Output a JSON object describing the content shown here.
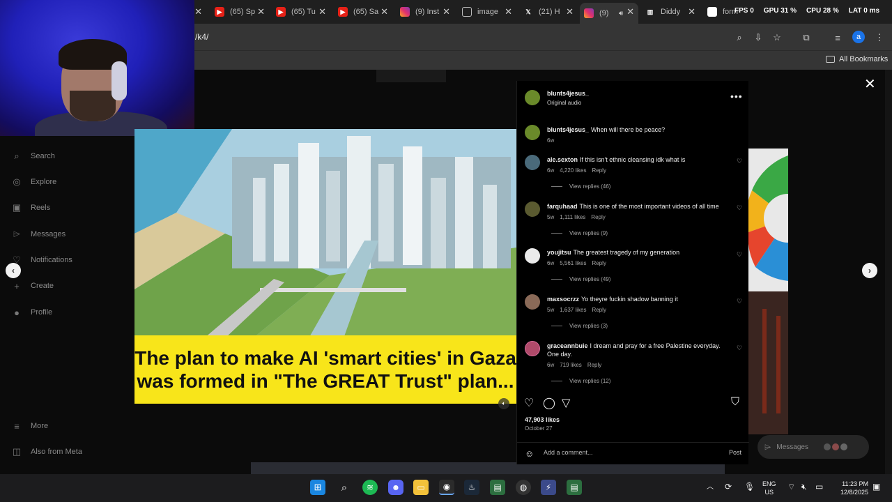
{
  "browser": {
    "tabs": [
      {
        "label": "(65) Sp",
        "icon": "youtube-icon"
      },
      {
        "label": "(65) Tu",
        "icon": "youtube-icon"
      },
      {
        "label": "(65) Sa",
        "icon": "youtube-icon"
      },
      {
        "label": "(9) Inst",
        "icon": "instagram-icon"
      },
      {
        "label": "image",
        "icon": "globe-icon"
      },
      {
        "label": "(21) H",
        "icon": "x-icon"
      },
      {
        "label": "(9)",
        "icon": "instagram-icon"
      },
      {
        "label": "Diddy",
        "icon": "app-icon"
      },
      {
        "label": "form",
        "icon": "google-icon"
      }
    ],
    "url": "/k4/",
    "all_bookmarks": "All Bookmarks",
    "profile_initial": "a"
  },
  "overlay_stats": {
    "fps_label": "FPS",
    "fps": "0",
    "gpu_label": "GPU",
    "gpu": "31 %",
    "cpu_label": "CPU",
    "cpu": "28 %",
    "lat_label": "LAT",
    "lat": "0 ms"
  },
  "sidebar": {
    "items": [
      {
        "label": "Search",
        "icon": "search-icon"
      },
      {
        "label": "Explore",
        "icon": "compass-icon"
      },
      {
        "label": "Reels",
        "icon": "reels-icon"
      },
      {
        "label": "Messages",
        "icon": "messenger-icon"
      },
      {
        "label": "Notifications",
        "icon": "heart-icon"
      },
      {
        "label": "Create",
        "icon": "plus-icon"
      },
      {
        "label": "Profile",
        "icon": "avatar-icon"
      },
      {
        "label": "More",
        "icon": "menu-icon"
      },
      {
        "label": "Also from Meta",
        "icon": "meta-icon"
      }
    ]
  },
  "media": {
    "caption_line1": "The plan to make AI 'smart cities' in Gaza",
    "caption_line2": "was formed in \"The GREAT Trust\" plan..."
  },
  "post": {
    "username": "blunts4jesus_",
    "audio": "Original audio",
    "caption_user": "blunts4jesus_",
    "caption_text": "When will there be peace?",
    "caption_age": "6w",
    "likes": "47,903 likes",
    "date": "October 27",
    "comment_placeholder": "Add a comment...",
    "post_label": "Post"
  },
  "comments": [
    {
      "user": "ale.sexton",
      "text": "If this isn't ethnic cleansing idk what is",
      "age": "6w",
      "likes": "4,220 likes",
      "reply": "Reply",
      "replies": "View replies (46)"
    },
    {
      "user": "farquhaad",
      "text": "This is one of the most important videos of all time",
      "age": "5w",
      "likes": "1,111 likes",
      "reply": "Reply",
      "replies": "View replies (9)"
    },
    {
      "user": "youjitsu",
      "text": "The greatest tragedy of my generation",
      "age": "6w",
      "likes": "5,561 likes",
      "reply": "Reply",
      "replies": "View replies (49)"
    },
    {
      "user": "maxsocrzz",
      "text": "Yo theyre fuckin shadow banning it",
      "age": "5w",
      "likes": "1,637 likes",
      "reply": "Reply",
      "replies": "View replies (3)"
    },
    {
      "user": "graceannbuie",
      "text": "I dream and pray for a free Palestine everyday. One day.",
      "age": "6w",
      "likes": "719 likes",
      "reply": "Reply",
      "replies": "View replies (12)"
    }
  ],
  "floating": {
    "messages": "Messages"
  },
  "taskbar": {
    "lang": "ENG",
    "region": "US",
    "time": "11:23 PM",
    "date": "12/8/2025"
  }
}
